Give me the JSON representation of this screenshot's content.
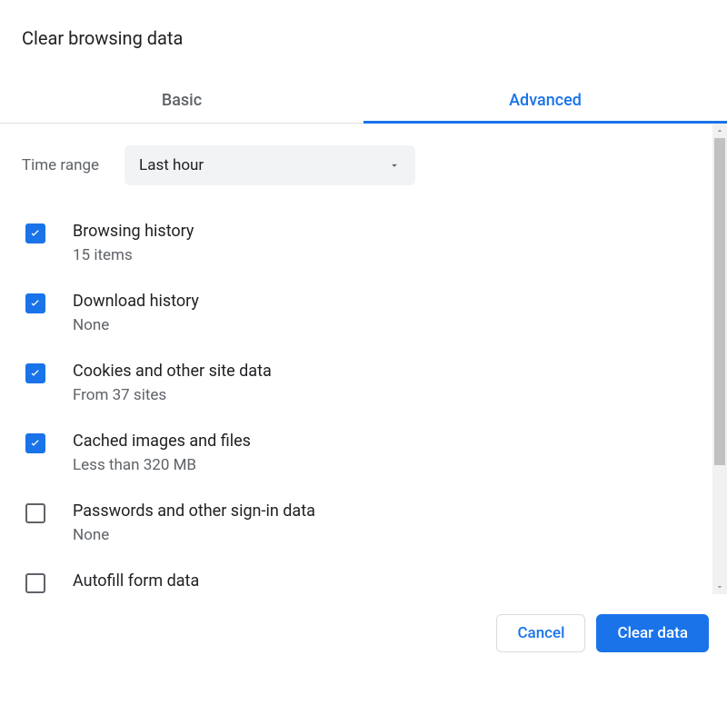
{
  "title": "Clear browsing data",
  "tabs": {
    "basic": "Basic",
    "advanced": "Advanced"
  },
  "active_tab": "advanced",
  "time_range": {
    "label": "Time range",
    "selected": "Last hour"
  },
  "options": [
    {
      "label": "Browsing history",
      "sub": "15 items",
      "checked": true
    },
    {
      "label": "Download history",
      "sub": "None",
      "checked": true
    },
    {
      "label": "Cookies and other site data",
      "sub": "From 37 sites",
      "checked": true
    },
    {
      "label": "Cached images and files",
      "sub": "Less than 320 MB",
      "checked": true
    },
    {
      "label": "Passwords and other sign-in data",
      "sub": "None",
      "checked": false
    },
    {
      "label": "Autofill form data",
      "sub": "",
      "checked": false
    }
  ],
  "buttons": {
    "cancel": "Cancel",
    "clear": "Clear data"
  }
}
